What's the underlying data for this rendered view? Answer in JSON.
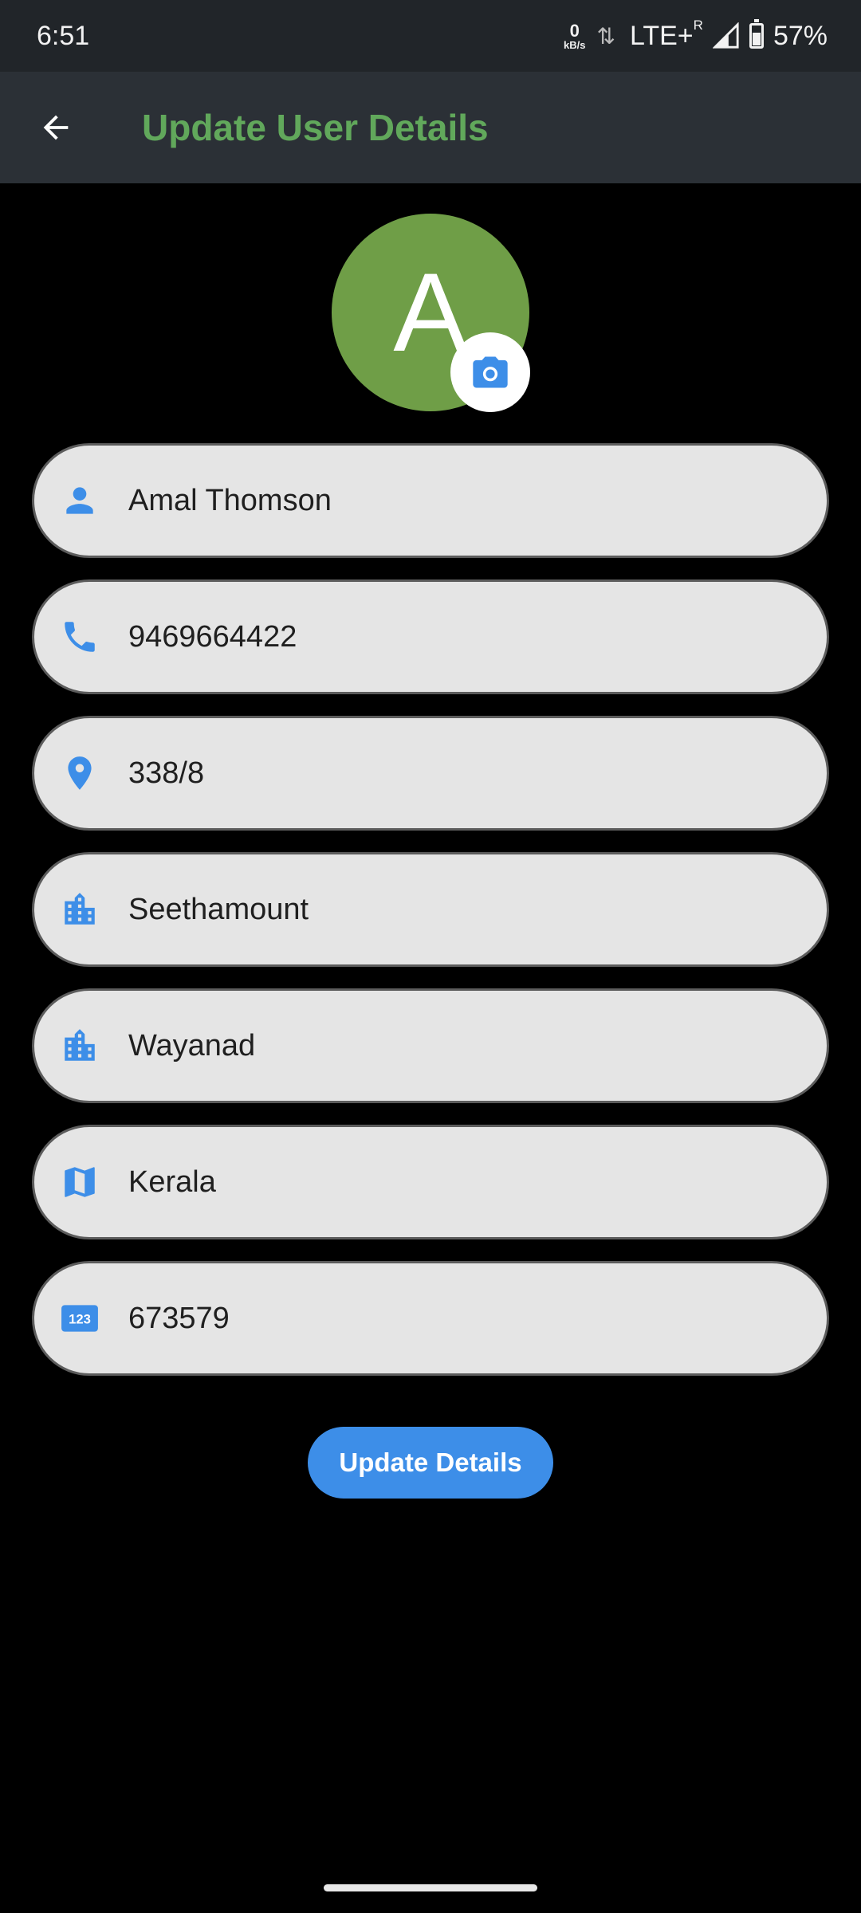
{
  "status_bar": {
    "time": "6:51",
    "net_speed_value": "0",
    "net_speed_unit": "kB/s",
    "network": "LTE+",
    "roaming": "R",
    "battery": "57%"
  },
  "app_bar": {
    "title": "Update User Details"
  },
  "avatar": {
    "initial": "A",
    "color": "#6f9e47"
  },
  "fields": [
    {
      "icon": "person-icon",
      "value": "Amal Thomson"
    },
    {
      "icon": "phone-icon",
      "value": "9469664422"
    },
    {
      "icon": "location-pin-icon",
      "value": "338/8"
    },
    {
      "icon": "building-icon",
      "value": "Seethamount"
    },
    {
      "icon": "building-icon",
      "value": "Wayanad"
    },
    {
      "icon": "map-icon",
      "value": "Kerala"
    },
    {
      "icon": "numbers-123-icon",
      "value": "673579"
    }
  ],
  "update_button": {
    "label": "Update Details"
  },
  "colors": {
    "accent": "#3d8ee8",
    "title_green": "#61a85b",
    "field_bg": "#e5e5e5"
  }
}
